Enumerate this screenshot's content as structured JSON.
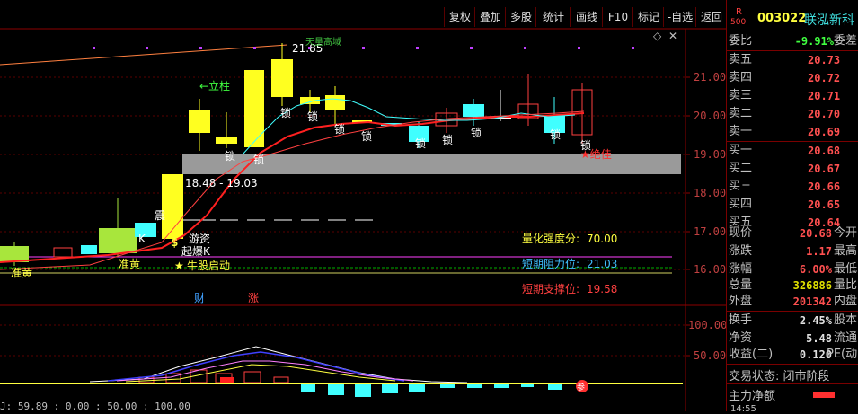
{
  "toolbar": {
    "buttons": [
      "复权",
      "叠加",
      "多股",
      "统计",
      "画线",
      "F10",
      "标记",
      "-自选",
      "返回"
    ]
  },
  "chart": {
    "price_axis": [
      "21.00",
      "20.00",
      "19.00",
      "18.00",
      "17.00",
      "16.00"
    ],
    "indicator_axis": [
      "100.00",
      "50.00"
    ],
    "annotations": {
      "high_label": "21.85",
      "high_note": "天量高域",
      "lizhu": "←立柱",
      "suo": "锁",
      "range": "18.48 - 19.03",
      "zhen": "震",
      "k": "K",
      "zhunhuang1": "准黄",
      "zhunhuang2": "准黄",
      "youzi": "游资",
      "qibao": "起爆K",
      "dollar": "$",
      "qidong": "牛股启动",
      "star": "★",
      "juejia": "★绝佳",
      "cai": "财",
      "zhang": "涨",
      "can": "参"
    },
    "strength_label": "量化强度分:",
    "strength_value": "70.00",
    "resistance_label": "短期阻力位:",
    "resistance_value": "21.03",
    "support_label": "短期支撑位:",
    "support_value": "19.58",
    "indicator_readout": "J: 59.89 : 0.00 : 50.00 : 100.00"
  },
  "quote": {
    "logo_top": "R",
    "logo_bottom": "500",
    "code": "003022",
    "name": "联泓新科",
    "weibi_label": "委比",
    "weibi_value": "-9.91%",
    "weicha_label": "委差",
    "sell": [
      {
        "label": "卖五",
        "price": "20.73"
      },
      {
        "label": "卖四",
        "price": "20.72"
      },
      {
        "label": "卖三",
        "price": "20.71"
      },
      {
        "label": "卖二",
        "price": "20.70"
      },
      {
        "label": "卖一",
        "price": "20.69"
      }
    ],
    "buy": [
      {
        "label": "买一",
        "price": "20.68"
      },
      {
        "label": "买二",
        "price": "20.67"
      },
      {
        "label": "买三",
        "price": "20.66"
      },
      {
        "label": "买四",
        "price": "20.65"
      },
      {
        "label": "买五",
        "price": "20.64"
      }
    ],
    "stats": [
      {
        "label": "现价",
        "value": "20.68",
        "extra": "今开",
        "color": "#ff5050"
      },
      {
        "label": "涨跌",
        "value": "1.17",
        "extra": "最高",
        "color": "#ff5050"
      },
      {
        "label": "涨幅",
        "value": "6.00%",
        "extra": "最低",
        "color": "#ff5050"
      },
      {
        "label": "总量",
        "value": "326886",
        "extra": "量比",
        "color": "#e0e000"
      },
      {
        "label": "外盘",
        "value": "201342",
        "extra": "内盘",
        "color": "#ff5050"
      }
    ],
    "stats2": [
      {
        "label": "换手",
        "value": "2.45%",
        "extra": "股本"
      },
      {
        "label": "净资",
        "value": "5.48",
        "extra": "流通"
      },
      {
        "label": "收益(二)",
        "value": "0.120",
        "extra": "PE(动"
      }
    ],
    "trade_status": "交易状态: 闭市阶段",
    "net_inflow": "主力净额",
    "time": "14:55"
  }
}
